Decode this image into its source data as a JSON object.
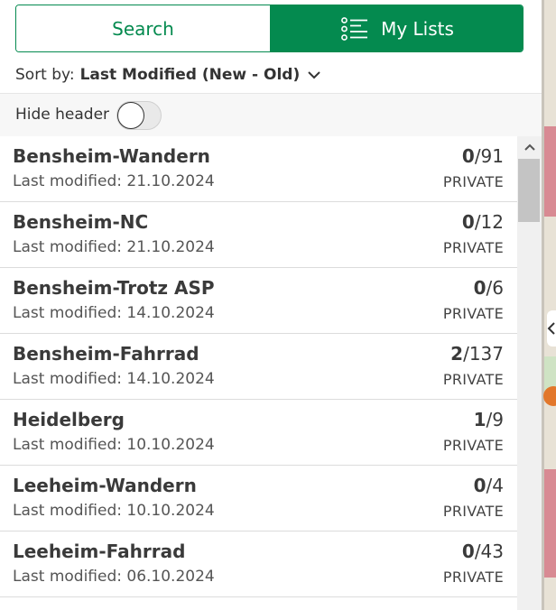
{
  "tabs": {
    "search_label": "Search",
    "lists_label": "My Lists",
    "list_icon": "list-icon"
  },
  "sort": {
    "label": "Sort by:",
    "value": "Last Modified (New - Old)"
  },
  "header_toggle": {
    "label": "Hide header",
    "on": false
  },
  "lists": [
    {
      "name": "Bensheim-Wandern",
      "date": "Last modified: 21.10.2024",
      "done": "0",
      "total": "/91",
      "privacy": "PRIVATE"
    },
    {
      "name": "Bensheim-NC",
      "date": "Last modified: 21.10.2024",
      "done": "0",
      "total": "/12",
      "privacy": "PRIVATE"
    },
    {
      "name": "Bensheim-Trotz ASP",
      "date": "Last modified: 14.10.2024",
      "done": "0",
      "total": "/6",
      "privacy": "PRIVATE"
    },
    {
      "name": "Bensheim-Fahrrad",
      "date": "Last modified: 14.10.2024",
      "done": "2",
      "total": "/137",
      "privacy": "PRIVATE"
    },
    {
      "name": "Heidelberg",
      "date": "Last modified: 10.10.2024",
      "done": "1",
      "total": "/9",
      "privacy": "PRIVATE"
    },
    {
      "name": "Leeheim-Wandern",
      "date": "Last modified: 10.10.2024",
      "done": "0",
      "total": "/4",
      "privacy": "PRIVATE"
    },
    {
      "name": "Leeheim-Fahrrad",
      "date": "Last modified: 06.10.2024",
      "done": "0",
      "total": "/43",
      "privacy": "PRIVATE"
    }
  ],
  "colors": {
    "brand_green": "#048a4f",
    "map_pin_blue": "#1f4e8a"
  }
}
